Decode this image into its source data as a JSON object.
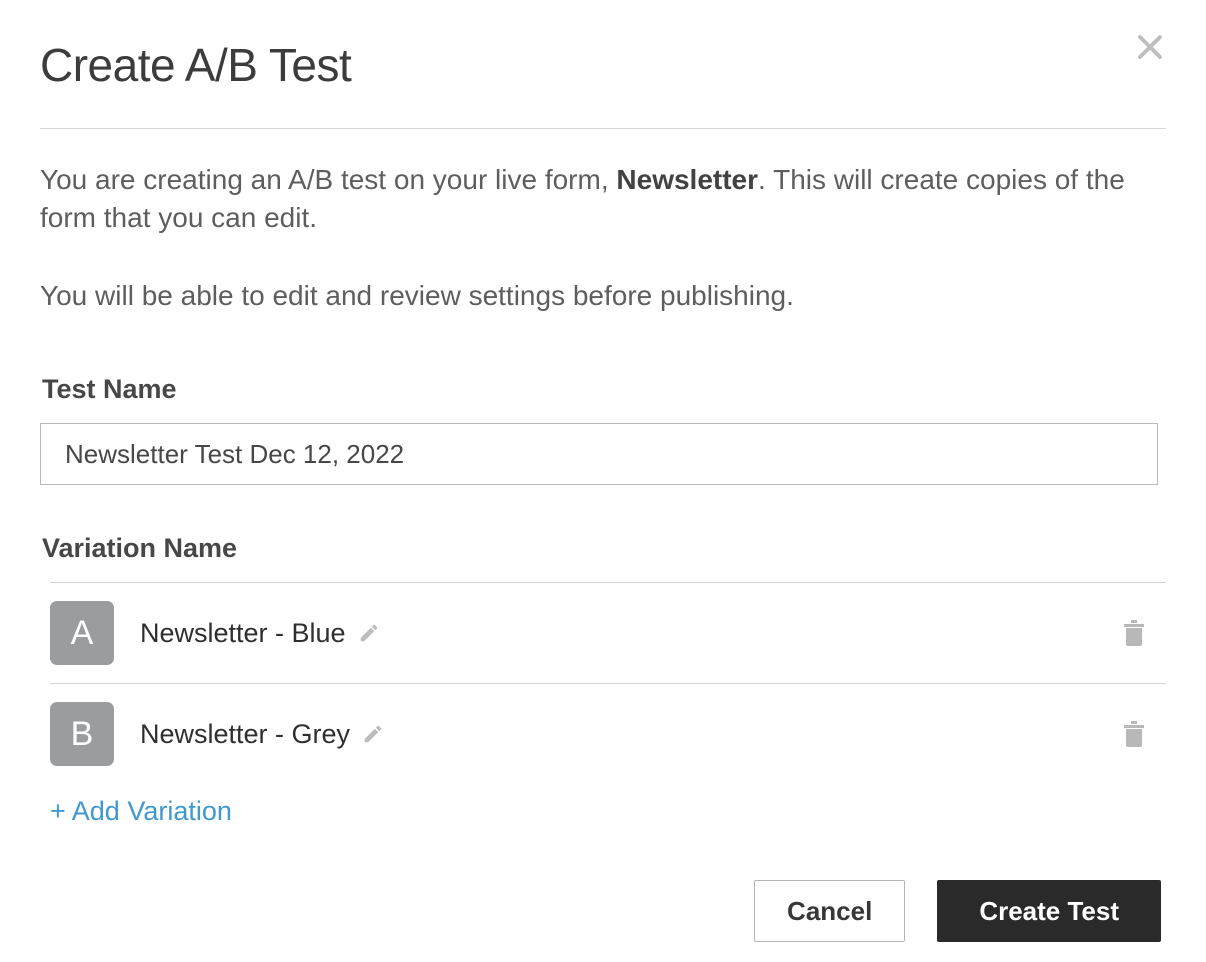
{
  "modal": {
    "title": "Create A/B Test",
    "intro": {
      "prefix": "You are creating an A/B test on your live form, ",
      "form_name": "Newsletter",
      "suffix": ". This will create copies of the form that you can edit.",
      "line2": "You will be able to edit and review settings before publishing."
    },
    "test_name": {
      "label": "Test Name",
      "value": "Newsletter Test Dec 12, 2022"
    },
    "variations": {
      "label": "Variation Name",
      "items": [
        {
          "badge": "A",
          "name": "Newsletter - Blue"
        },
        {
          "badge": "B",
          "name": "Newsletter - Grey"
        }
      ],
      "add_label": "+ Add Variation"
    },
    "footer": {
      "cancel": "Cancel",
      "submit": "Create Test"
    }
  }
}
